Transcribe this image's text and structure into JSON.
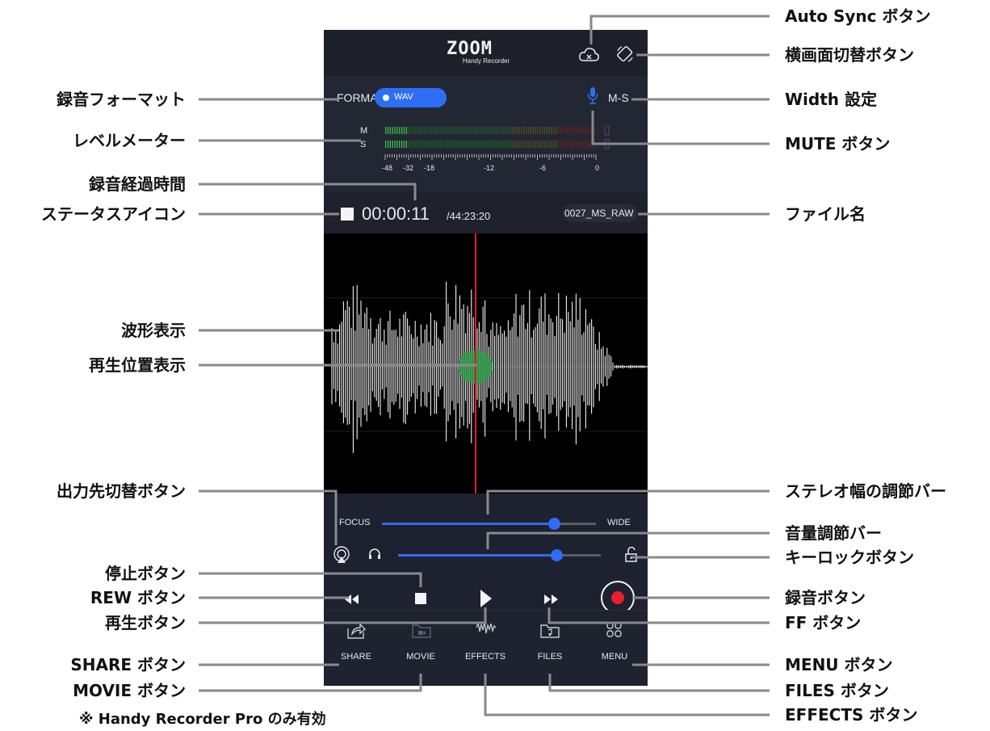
{
  "app": {
    "logo_text": "ZOOM",
    "logo_subtitle": "Handy Recorder",
    "format_label": "FORMAT",
    "format_value": "WAV",
    "width_value": "M-S",
    "meter_channels": [
      "M",
      "S"
    ],
    "meter_ticks": [
      "-48",
      "-32",
      "-18",
      "-12",
      "-6",
      "0"
    ],
    "elapsed_time": "00:00:11",
    "remaining_time": "/44:23:20",
    "file_name": "0027_MS_RAW",
    "stereo_width": {
      "left_label": "FOCUS",
      "right_label": "WIDE",
      "value": 0.74
    },
    "volume": {
      "value": 0.78
    },
    "transport": {
      "rew": "rewind-icon",
      "stop": "stop-icon",
      "play": "play-icon",
      "ff": "fast-forward-icon",
      "record": "record-icon"
    },
    "tabs": [
      {
        "label": "SHARE",
        "icon": "share-icon",
        "enabled": true
      },
      {
        "label": "MOVIE",
        "icon": "movie-icon",
        "enabled": false
      },
      {
        "label": "EFFECTS",
        "icon": "effects-icon",
        "enabled": true
      },
      {
        "label": "FILES",
        "icon": "files-icon",
        "enabled": true
      },
      {
        "label": "MENU",
        "icon": "menu-icon",
        "enabled": true
      }
    ],
    "colors": {
      "accent": "#2f6cf2",
      "record": "#e8202a",
      "playhead": "#e02020",
      "playhead_marker": "#2e9d4a",
      "background": "#1c1f29"
    }
  },
  "callouts": {
    "left": [
      "録音フォーマット",
      "レベルメーター",
      "録音経過時間",
      "ステータスアイコン",
      "波形表示",
      "再生位置表示",
      "出力先切替ボタン",
      "停止ボタン",
      "REW ボタン",
      "再生ボタン",
      "SHARE ボタン",
      "MOVIE ボタン"
    ],
    "right": [
      "Auto Sync ボタン",
      "横画面切替ボタン",
      "Width 設定",
      "MUTE ボタン",
      "ファイル名",
      "ステレオ幅の調節バー",
      "音量調節バー",
      "キーロックボタン",
      "録音ボタン",
      "FF ボタン",
      "MENU ボタン",
      "FILES ボタン",
      "EFFECTS ボタン"
    ],
    "note": "※ Handy Recorder Pro のみ有効"
  }
}
